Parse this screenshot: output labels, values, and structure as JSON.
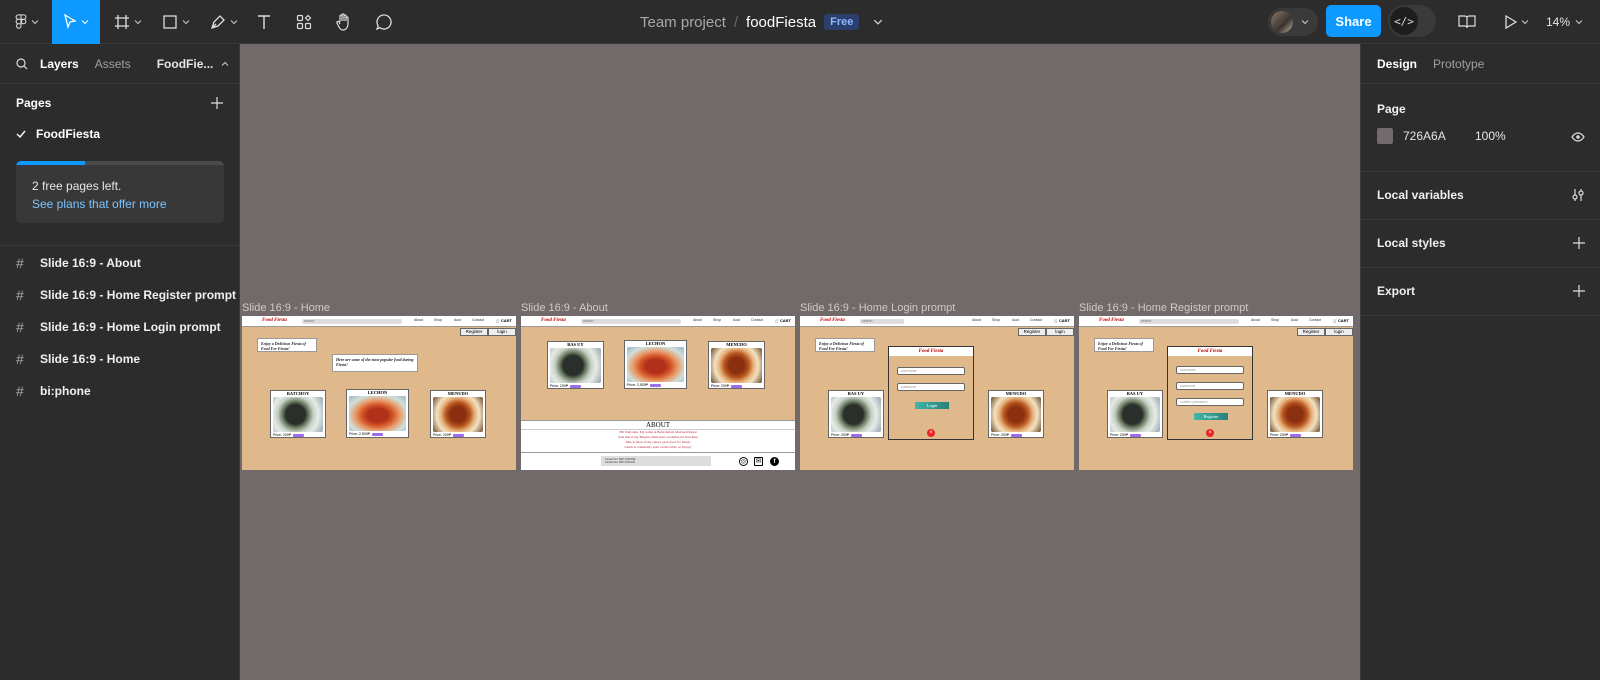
{
  "toolbar": {
    "project": "Team project",
    "separator": "/",
    "file_name": "foodFiesta",
    "plan_badge": "Free",
    "share_label": "Share",
    "dev_mode_icon": "</>",
    "zoom": "14%",
    "accent_color": "#0d99ff"
  },
  "left_panel": {
    "tabs": [
      "Layers",
      "Assets"
    ],
    "file_selector": "FoodFie...",
    "pages_heading": "Pages",
    "current_page": "FoodFiesta",
    "promo": {
      "title": "2 free pages left.",
      "link": "See plans that offer more",
      "used_fraction": 0.33
    },
    "layers": [
      "Slide 16:9 - About",
      "Slide 16:9 - Home Register prompt",
      "Slide 16:9 - Home Login prompt",
      "Slide 16:9 - Home",
      "bi:phone"
    ]
  },
  "canvas": {
    "background": "#726a6a",
    "frames": [
      {
        "label": "Slide 16:9 - Home",
        "nav": {
          "logo": "Food Fiesta",
          "search": "search",
          "links": [
            "About",
            "Shop",
            "Aout",
            "Contact"
          ],
          "cart": "🛒CART",
          "register": "Register",
          "login": "login"
        },
        "hero": "Enjoy a Delicious Fiesta of Food For Fiesta!",
        "popular": "Here are some of the most popular food during Fiesta!",
        "cards": [
          {
            "title": "BATCHOY",
            "price": "Price: 200₱"
          },
          {
            "title": "LECHON",
            "price": "Price: 2,500₱"
          },
          {
            "title": "MENUDO",
            "price": "Price: 200₱"
          }
        ]
      },
      {
        "label": "Slide 16:9 - About",
        "nav": {
          "logo": "Food Fiesta",
          "search": "search",
          "links": [
            "About",
            "Shop",
            "Aout",
            "Contact"
          ],
          "cart": "🛒CART"
        },
        "cards": [
          {
            "title": "BAS UY",
            "price": "Price: 200₱"
          },
          {
            "title": "LECHON",
            "price": "Price: 2,500₱"
          },
          {
            "title": "MENUDO",
            "price": "Price: 200₱"
          }
        ],
        "about": {
          "title": "ABOUT",
          "lines": [
            "Hi! Welcome, My name is Belle Rafals Maxwell Reyal",
            "And this is my Filipino Delicacies available for Purchase",
            "This is most of the starter pack food for fiesta!",
            "which is commonly seen on the table, so Enjoy!"
          ],
          "contact": [
            "Contact No: 0967-AFKDNE",
            "Contact No: 0967-KWL235"
          ]
        }
      },
      {
        "label": "Slide 16:9 - Home Login prompt",
        "nav": {
          "logo": "Food Fiesta",
          "search": "search",
          "links": [
            "About",
            "Shop",
            "Aout",
            "Contact"
          ],
          "cart": "🛒CART",
          "register": "Register",
          "login": "login"
        },
        "hero": "Enjoy a Delicious Fiesta of Food For Fiesta!",
        "cards": [
          {
            "title": "BAS UY",
            "price": "Price: 200₱"
          },
          {
            "title": "MENUDO",
            "price": "Price: 200₱"
          }
        ],
        "modal": {
          "title": "Food Fiesta",
          "fields": [
            "username",
            "password"
          ],
          "button": "Login"
        }
      },
      {
        "label": "Slide 16:9 - Home Register prompt",
        "nav": {
          "logo": "Food Fiesta",
          "search": "search",
          "links": [
            "About",
            "Shop",
            "Aout",
            "Contact"
          ],
          "cart": "🛒CART",
          "register": "Register",
          "login": "login"
        },
        "hero": "Enjoy a Delicious Fiesta of Food For Fiesta!",
        "cards": [
          {
            "title": "BAS UY",
            "price": "Price: 200₱"
          },
          {
            "title": "MENUDO",
            "price": "Price: 200₱"
          }
        ],
        "modal": {
          "title": "Food Fiesta",
          "fields": [
            "username",
            "password",
            "confirm password"
          ],
          "button": "Register"
        }
      }
    ]
  },
  "right_panel": {
    "tabs": [
      "Design",
      "Prototype"
    ],
    "page_heading": "Page",
    "page_color": "726A6A",
    "page_color_hex": "#726a6a",
    "page_opacity": "100%",
    "sections": [
      "Local variables",
      "Local styles",
      "Export"
    ]
  }
}
